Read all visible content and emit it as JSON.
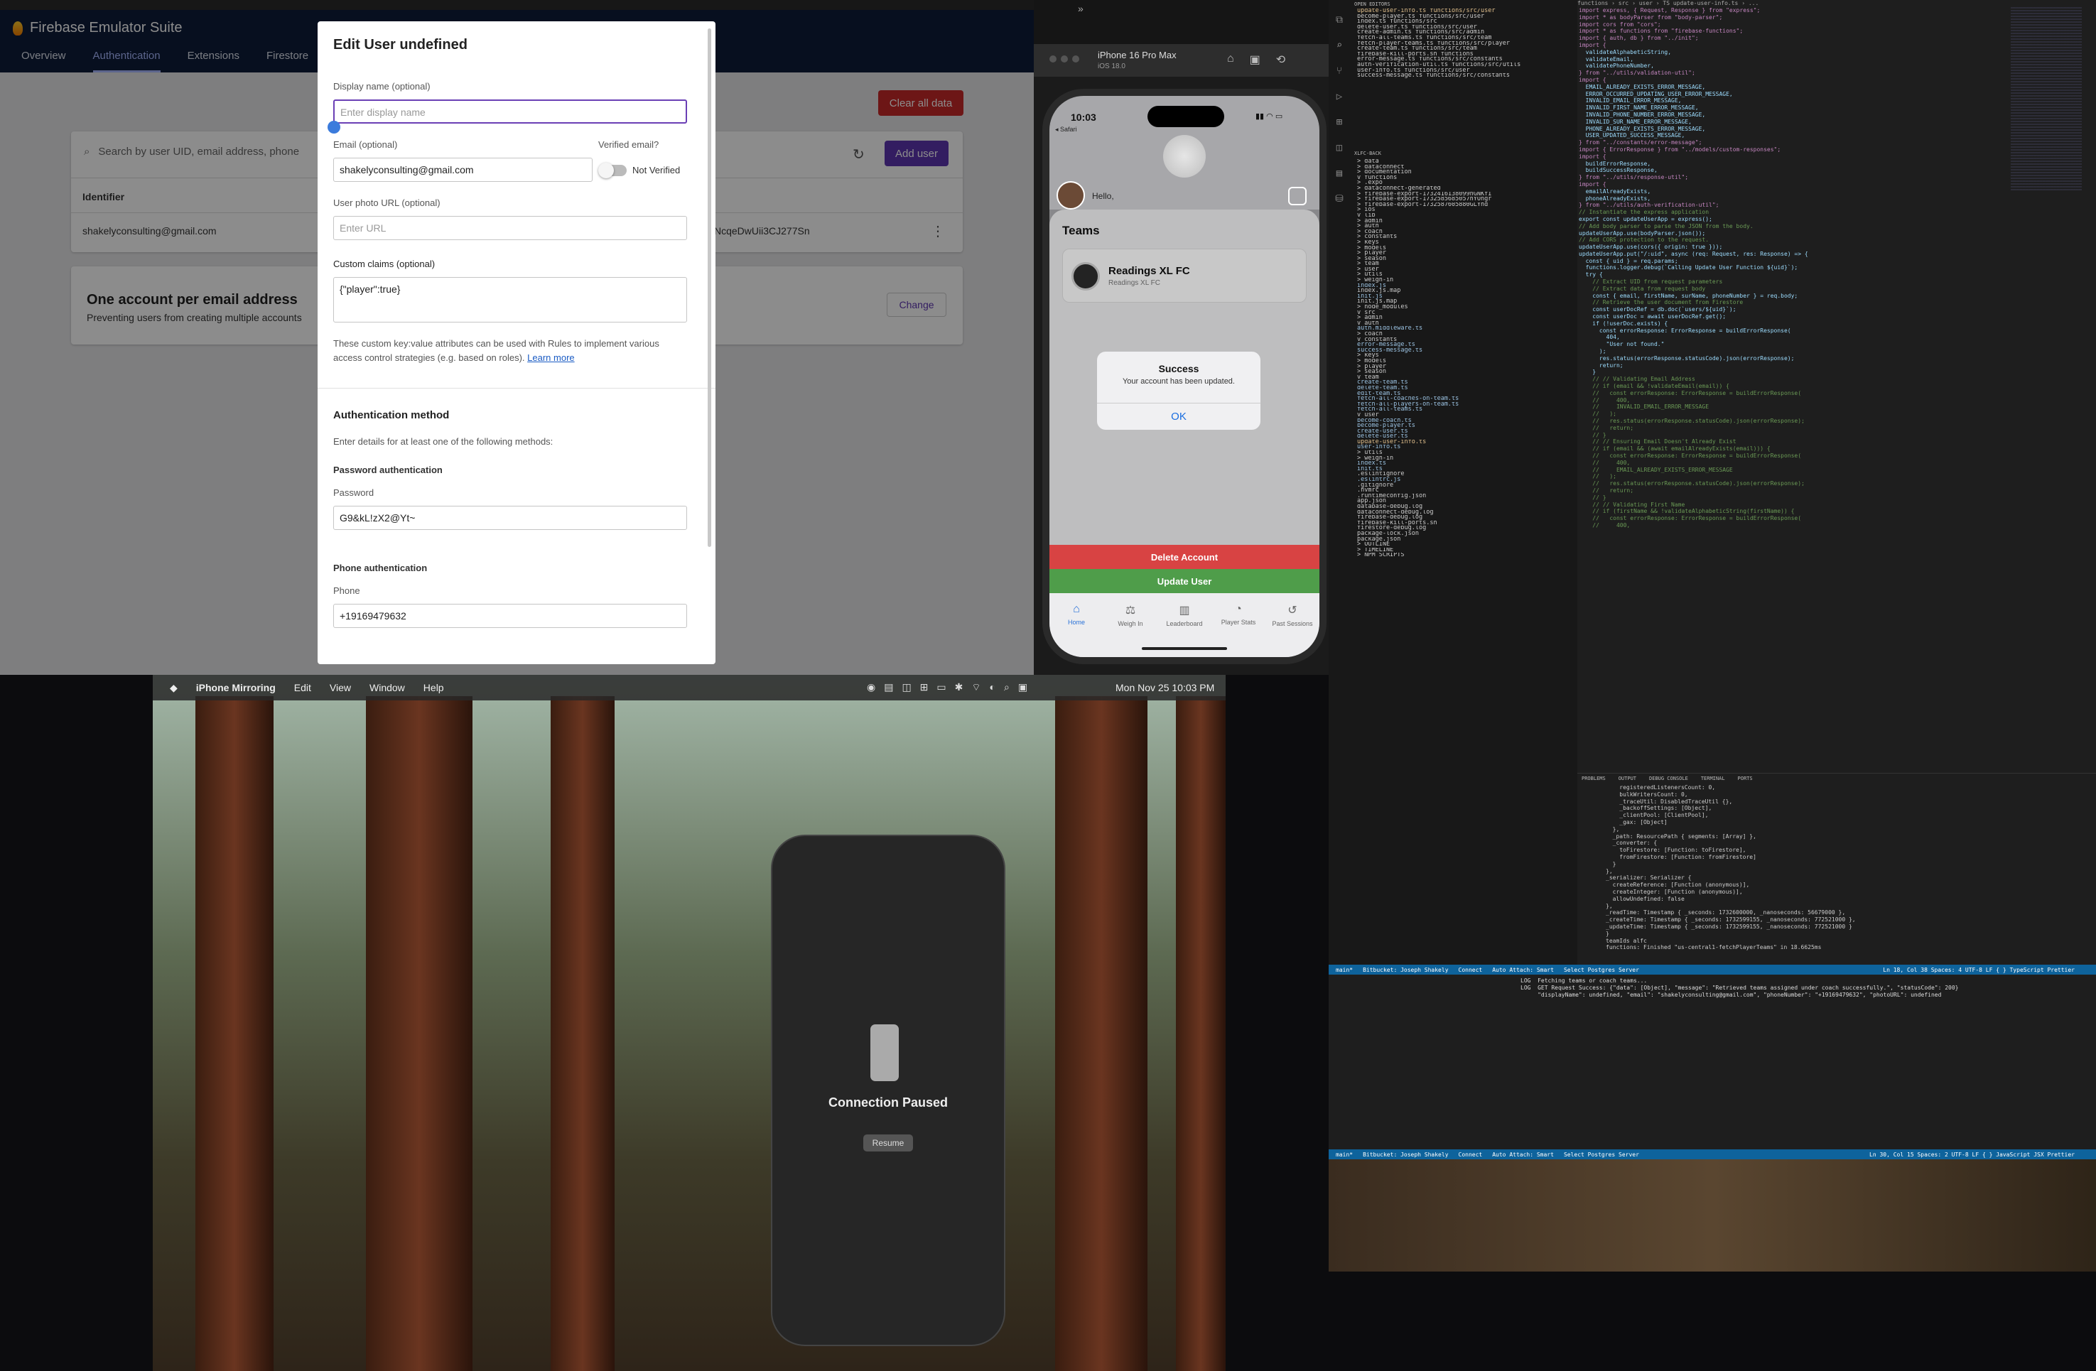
{
  "firebase": {
    "title": "Firebase Emulator Suite",
    "tabs": [
      "Overview",
      "Authentication",
      "Extensions",
      "Firestore"
    ],
    "clear_all_label": "Clear all data",
    "search_placeholder": "Search by user UID, email address, phone",
    "add_user_label": "Add user",
    "table_header": "Identifier",
    "row_identifier": "shakelyconsulting@gmail.com",
    "row_uid": "NcqeDwUii3CJ277Sn",
    "account_title": "One account per email address",
    "account_desc": "Preventing users from creating multiple accounts",
    "change_label": "Change",
    "dialog": {
      "title": "Edit User undefined",
      "display_name_label": "Display name (optional)",
      "display_name_placeholder": "Enter display name",
      "email_label": "Email (optional)",
      "email_value": "shakelyconsulting@gmail.com",
      "verified_label": "Verified email?",
      "verified_state": "Not Verified",
      "photo_label": "User photo URL (optional)",
      "photo_placeholder": "Enter URL",
      "claims_label": "Custom claims (optional)",
      "claims_value": "{\"player\":true}",
      "claims_hint": "These custom key:value attributes can be used with Rules to implement various access control strategies (e.g. based on roles).",
      "learn_more": "Learn more",
      "auth_method_title": "Authentication method",
      "auth_method_hint": "Enter details for at least one of the following methods:",
      "password_title": "Password authentication",
      "password_label": "Password",
      "password_value": "G9&kL!zX2@Yt~",
      "phone_title": "Phone authentication",
      "phone_label": "Phone",
      "phone_value": "+19169479632"
    }
  },
  "simulator": {
    "device": "iPhone 16 Pro Max",
    "os": "iOS 18.0",
    "time": "10:03",
    "back": "◂ Safari",
    "greeting": "Hello,",
    "teams_title": "Teams",
    "team_name": "Readings XL FC",
    "team_sub": "Readings XL FC",
    "alert_title": "Success",
    "alert_message": "Your account has been updated.",
    "alert_ok": "OK",
    "delete_label": "Delete Account",
    "update_label": "Update User",
    "tabs": [
      "Home",
      "Weigh In",
      "Leaderboard",
      "Player Stats",
      "Past Sessions"
    ]
  },
  "mirroring": {
    "app": "iPhone Mirroring",
    "menus": [
      "Edit",
      "View",
      "Window",
      "Help"
    ],
    "datetime": "Mon Nov 25  10:03 PM",
    "status": "Connection Paused",
    "resume_label": "Resume"
  },
  "vscode": {
    "breadcrumb": "functions › src › user › TS update-user-info.ts › ...",
    "open_editors": [
      "update-user-info.ts  functions/src/user",
      "become-player.ts  functions/src/user",
      "index.ts  functions/src",
      "delete-user.ts  functions/src/user",
      "create-admin.ts  functions/src/admin",
      "fetch-all-teams.ts  functions/src/team",
      "fetch-player-teams.ts  functions/src/player",
      "create-team.ts  functions/src/team",
      "firebase-kill-ports.sh  functions",
      "error-message.ts  functions/src/constants",
      "auth-verification-util.ts  functions/src/utils",
      "user-info.ts  functions/src/user",
      "success-message.ts  functions/src/constants"
    ],
    "project": "XLFC-BACK",
    "tree": [
      "> data",
      "> dataconnect",
      "> documentation",
      "v functions",
      "  > .expo",
      "  > dataconnect-generated",
      "  > firebase-export-1732416138099nGNKfI",
      "  > firebase-export-1732585685057hYOngr",
      "  > firebase-export-1732587605880GLYhd",
      "  > ios",
      "  v lib",
      "    > admin",
      "    > auth",
      "    > coach",
      "    > constants",
      "    > keys",
      "    > models",
      "    > player",
      "    > season",
      "    > team",
      "    > user",
      "    > utils",
      "    > weigh-in",
      "      index.js",
      "      index.js.map",
      "      init.js",
      "      init.js.map",
      "  > node_modules",
      "  v src",
      "    > admin",
      "    v auth",
      "      auth.middleware.ts",
      "    > coach",
      "    v constants",
      "      error-message.ts",
      "      success-message.ts",
      "    > keys",
      "    > models",
      "    > player",
      "    > season",
      "    v team",
      "      create-team.ts",
      "      delete-team.ts",
      "      edit-team.ts",
      "      fetch-all-coaches-on-team.ts",
      "      fetch-all-players-on-team.ts",
      "      fetch-all-teams.ts",
      "    v user",
      "      become-coach.ts",
      "      become-player.ts",
      "      create-user.ts",
      "      delete-user.ts",
      "      update-user-info.ts",
      "      user-info.ts",
      "    > utils",
      "    > weigh-in",
      "      index.ts",
      "      init.ts",
      "    .eslintignore",
      "    .eslintrc.js",
      "    .gitignore",
      "    .nvmrc",
      "    .runtimeconfig.json",
      "    app.json",
      "    database-debug.log",
      "    dataconnect-debug.log",
      "    firebase-debug.log",
      "    firebase-kill-ports.sh",
      "    firestore-debug.log",
      "    package-lock.json",
      "    package.json",
      "> OUTLINE",
      "> TIMELINE",
      "> NPM SCRIPTS"
    ],
    "code": [
      "import express, { Request, Response } from \"express\";",
      "import * as bodyParser from \"body-parser\";",
      "import cors from \"cors\";",
      "import * as functions from \"firebase-functions\";",
      "import { auth, db } from \"../init\";",
      "import {",
      "  validateAlphabeticString,",
      "  validateEmail,",
      "  validatePhoneNumber,",
      "} from \"../utils/validation-util\";",
      "import {",
      "  EMAIL_ALREADY_EXISTS_ERROR_MESSAGE,",
      "  ERROR_OCCURRED_UPDATING_USER_ERROR_MESSAGE,",
      "  INVALID_EMAIL_ERROR_MESSAGE,",
      "  INVALID_FIRST_NAME_ERROR_MESSAGE,",
      "  INVALID_PHONE_NUMBER_ERROR_MESSAGE,",
      "  INVALID_SUR_NAME_ERROR_MESSAGE,",
      "  PHONE_ALREADY_EXISTS_ERROR_MESSAGE,",
      "  USER_UPDATED_SUCCESS_MESSAGE,",
      "} from \"../constants/error-message\";",
      "import { ErrorResponse } from \"../models/custom-responses\";",
      "import {",
      "  buildErrorResponse,",
      "  buildSuccessResponse,",
      "} from \"../utils/response-util\";",
      "import {",
      "  emailAlreadyExists,",
      "  phoneAlreadyExists,",
      "} from \"../utils/auth-verification-util\";",
      "",
      "// Instantiate the express application",
      "export const updateUserApp = express();",
      "",
      "// Add body parser to parse the JSON from the body.",
      "updateUserApp.use(bodyParser.json());",
      "",
      "// Add CORS protection to the request.",
      "updateUserApp.use(cors({ origin: true }));",
      "",
      "updateUserApp.put(\"/:uid\", async (req: Request, res: Response) => {",
      "  const { uid } = req.params;",
      "  functions.logger.debug(`Calling Update User Function ${uid}`);",
      "  try {",
      "    // Extract UID from request parameters",
      "",
      "    // Extract data from request body",
      "    const { email, firstName, surName, phoneNumber } = req.body;",
      "",
      "    // Retrieve the user document from Firestore",
      "    const userDocRef = db.doc(`users/${uid}`);",
      "    const userDoc = await userDocRef.get();",
      "",
      "    if (!userDoc.exists) {",
      "      const errorResponse: ErrorResponse = buildErrorResponse(",
      "        404,",
      "        \"User not found.\"",
      "      );",
      "      res.status(errorResponse.statusCode).json(errorResponse);",
      "      return;",
      "    }",
      "",
      "    // // Validating Email Address",
      "    // if (email && !validateEmail(email)) {",
      "    //   const errorResponse: ErrorResponse = buildErrorResponse(",
      "    //     400,",
      "    //     INVALID_EMAIL_ERROR_MESSAGE",
      "    //   );",
      "    //   res.status(errorResponse.statusCode).json(errorResponse);",
      "    //   return;",
      "    // }",
      "",
      "    // // Ensuring Email Doesn't Already Exist",
      "    // if (email && (await emailAlreadyExists(email))) {",
      "    //   const errorResponse: ErrorResponse = buildErrorResponse(",
      "    //     400,",
      "    //     EMAIL_ALREADY_EXISTS_ERROR_MESSAGE",
      "    //   );",
      "    //   res.status(errorResponse.statusCode).json(errorResponse);",
      "    //   return;",
      "    // }",
      "",
      "    // // Validating First Name",
      "    // if (firstName && !validateAlphabeticString(firstName)) {",
      "    //   const errorResponse: ErrorResponse = buildErrorResponse(",
      "    //     400,"
    ],
    "panel_tabs": [
      "PROBLEMS",
      "OUTPUT",
      "DEBUG CONSOLE",
      "TERMINAL",
      "PORTS"
    ],
    "terminal": [
      "    registeredListenersCount: 0,",
      "    bulkWritersCount: 0,",
      "    _traceUtil: DisabledTraceUtil {},",
      "    _backoffSettings: [Object],",
      "    _clientPool: [ClientPool],",
      "    _gax: [Object]",
      "  },",
      "  _path: ResourcePath { segments: [Array] },",
      "  _converter: {",
      "    toFirestore: [Function: toFirestore],",
      "    fromFirestore: [Function: fromFirestore]",
      "  }",
      "},",
      "_serializer: Serializer {",
      "  createReference: [Function (anonymous)],",
      "  createInteger: [Function (anonymous)],",
      "  allowUndefined: false",
      "},",
      "_readTime: Timestamp { _seconds: 1732600000, _nanoseconds: 56679000 },",
      "_createTime: Timestamp { _seconds: 1732599155, _nanoseconds: 772521000 },",
      "_updateTime: Timestamp { _seconds: 1732599155, _nanoseconds: 772521000 }",
      "}",
      "teamIds alfc",
      "functions: Finished \"us-central1-fetchPlayerTeams\" in 18.6625ms"
    ],
    "status": "Ln 18, Col 38   Spaces: 4   UTF-8   LF   { } TypeScript   Prettier",
    "branch": "main*",
    "bitbucket": "Bitbucket: Joseph Shakely",
    "connect": "Connect",
    "attach": "Auto Attach: Smart",
    "postgres": "Select Postgres Server",
    "log": [
      "LOG  Fetching teams or coach teams...",
      "LOG  GET Request Success: {\"data\": [Object], \"message\": \"Retrieved teams assigned under coach successfully.\", \"statusCode\": 200}",
      "     \"displayName\": undefined, \"email\": \"shakelyconsulting@gmail.com\", \"phoneNumber\": \"+19169479632\", \"photoURL\": undefined"
    ],
    "status2": "Ln 30, Col 15   Spaces: 2   UTF-8   LF   { } JavaScript JSX   Prettier"
  }
}
